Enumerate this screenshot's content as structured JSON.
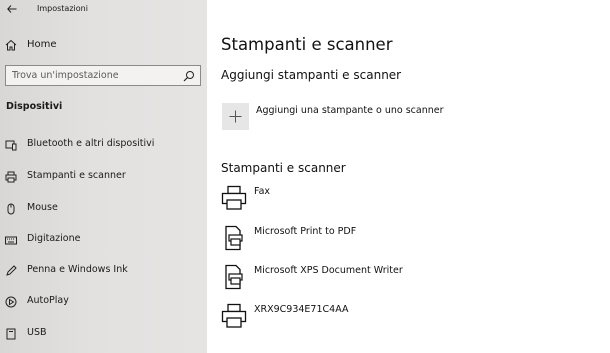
{
  "window": {
    "title": "Impostazioni"
  },
  "sidebar": {
    "home_label": "Home",
    "search_placeholder": "Trova un'impostazione",
    "section_title": "Dispositivi",
    "items": [
      {
        "label": "Bluetooth e altri dispositivi",
        "icon": "bluetooth-icon"
      },
      {
        "label": "Stampanti e scanner",
        "icon": "printer-icon"
      },
      {
        "label": "Mouse",
        "icon": "mouse-icon"
      },
      {
        "label": "Digitazione",
        "icon": "keyboard-icon"
      },
      {
        "label": "Penna e Windows Ink",
        "icon": "pen-icon"
      },
      {
        "label": "AutoPlay",
        "icon": "autoplay-icon"
      },
      {
        "label": "USB",
        "icon": "usb-icon"
      }
    ]
  },
  "main": {
    "title": "Stampanti e scanner",
    "add_section_title": "Aggiungi stampanti e scanner",
    "add_button_label": "Aggiungi una stampante o uno scanner",
    "list_title": "Stampanti e scanner",
    "printers": [
      {
        "name": "Fax",
        "icon": "fax-printer-icon"
      },
      {
        "name": "Microsoft Print to PDF",
        "icon": "document-printer-icon"
      },
      {
        "name": "Microsoft XPS Document Writer",
        "icon": "document-printer-icon"
      },
      {
        "name": "XRX9C934E71C4AA",
        "icon": "printer-icon"
      }
    ]
  }
}
